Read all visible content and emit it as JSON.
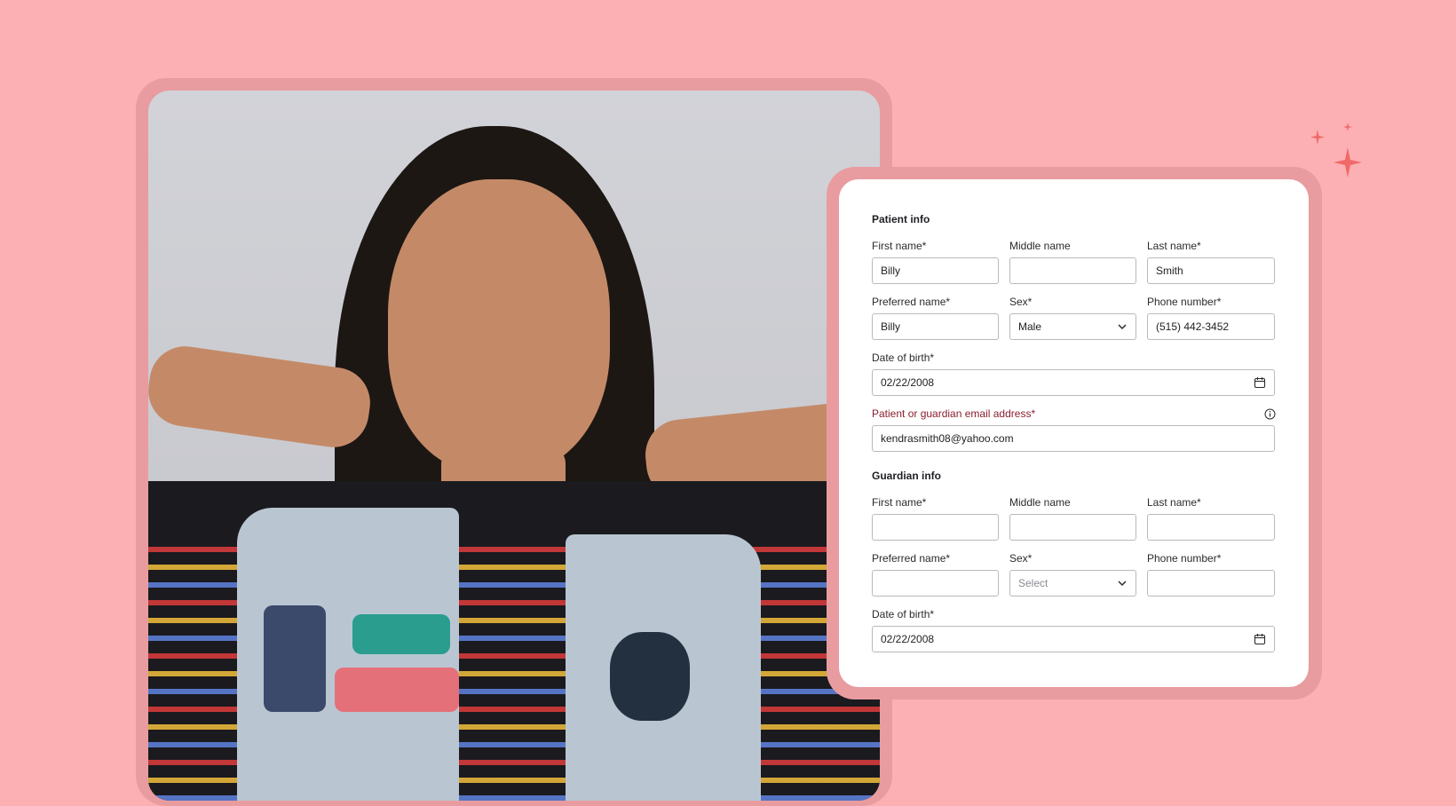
{
  "patient": {
    "section_title": "Patient info",
    "first_name_label": "First name*",
    "first_name_value": "Billy",
    "middle_name_label": "Middle name",
    "middle_name_value": "",
    "last_name_label": "Last name*",
    "last_name_value": "Smith",
    "preferred_name_label": "Preferred name*",
    "preferred_name_value": "Billy",
    "sex_label": "Sex*",
    "sex_value": "Male",
    "phone_label": "Phone number*",
    "phone_value": "(515) 442-3452",
    "dob_label": "Date of birth*",
    "dob_value": "02/22/2008",
    "email_label": "Patient or guardian email address*",
    "email_value": "kendrasmith08@yahoo.com"
  },
  "guardian": {
    "section_title": "Guardian info",
    "first_name_label": "First name*",
    "first_name_value": "",
    "middle_name_label": "Middle name",
    "middle_name_value": "",
    "last_name_label": "Last name*",
    "last_name_value": "",
    "preferred_name_label": "Preferred name*",
    "preferred_name_value": "",
    "sex_label": "Sex*",
    "sex_placeholder": "Select",
    "phone_label": "Phone number*",
    "phone_value": "",
    "dob_label": "Date of birth*",
    "dob_value": "02/22/2008"
  },
  "icons": {
    "dropdown": "chevron-down-icon",
    "calendar": "calendar-icon",
    "info": "info-icon",
    "sparkle": "sparkle-icon"
  },
  "colors": {
    "background": "#fcb0b3",
    "frame": "#e89ca0",
    "error_label": "#8a1f2e",
    "sparkle": "#f06a6a"
  }
}
